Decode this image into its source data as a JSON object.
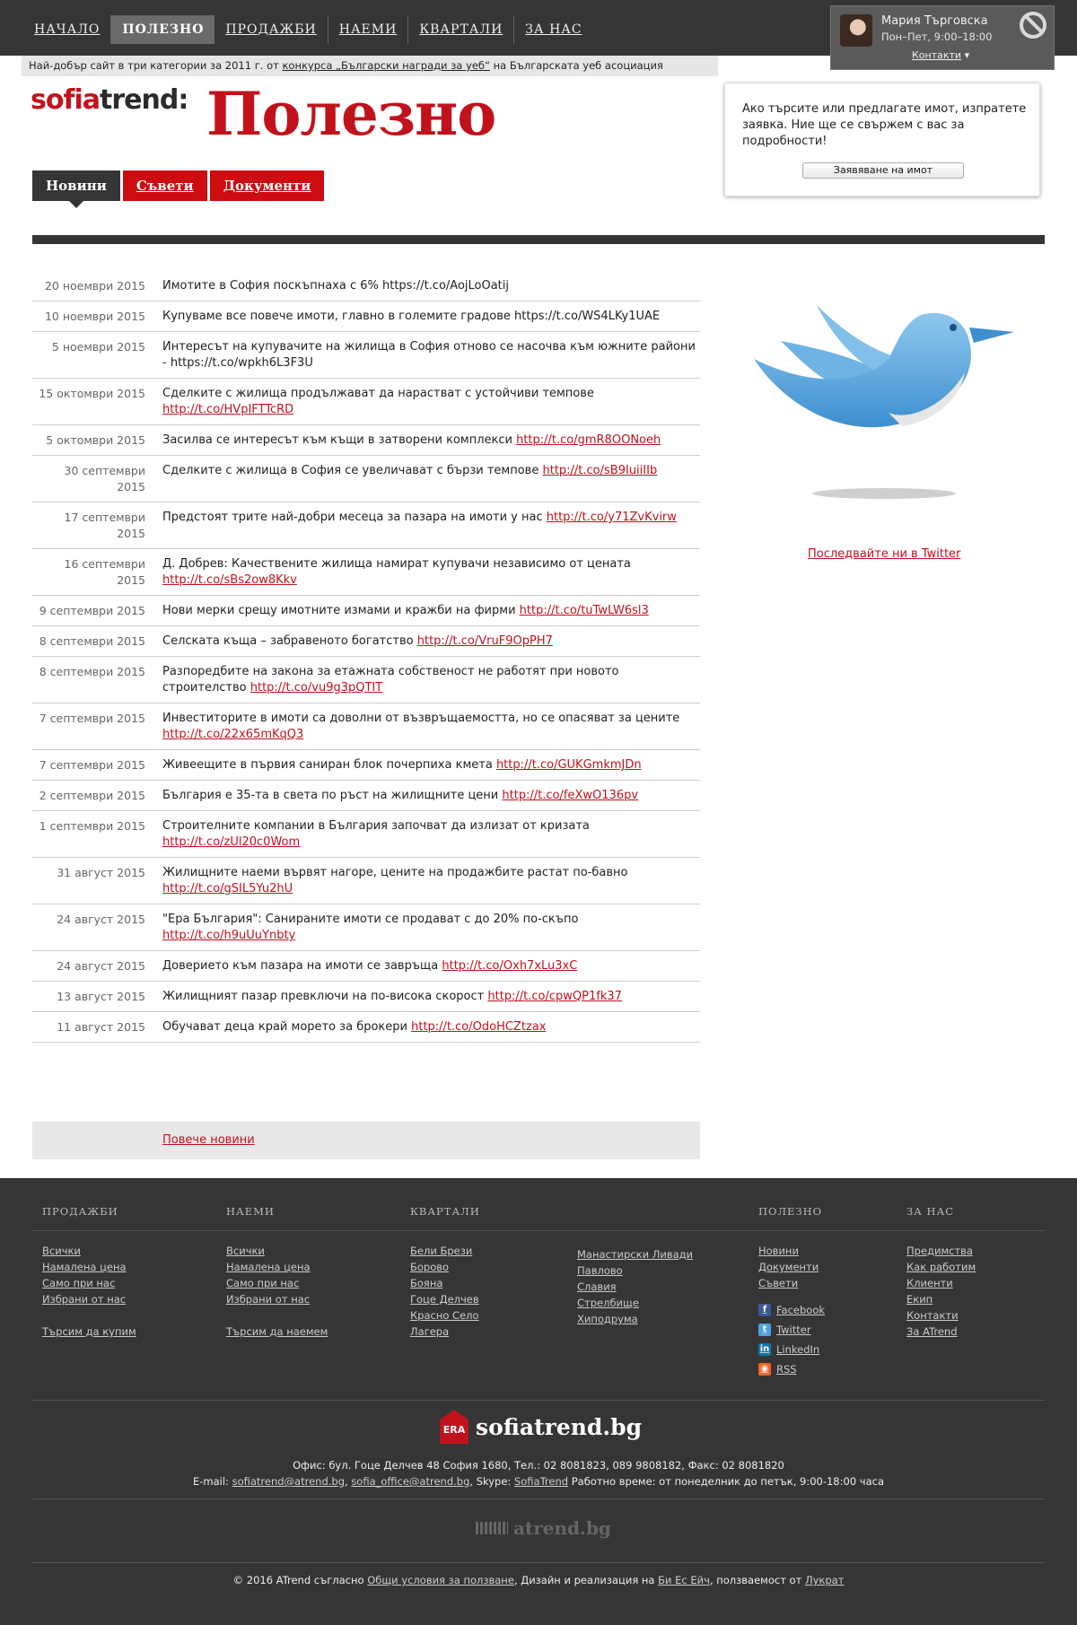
{
  "nav": {
    "items": [
      {
        "label": "НАЧАЛО",
        "active": false
      },
      {
        "label": "ПОЛЕЗНО",
        "active": true
      },
      {
        "label": "ПРОДАЖБИ",
        "active": false
      },
      {
        "label": "НАЕМИ",
        "active": false
      },
      {
        "label": "КВАРТАЛИ",
        "active": false
      },
      {
        "label": "ЗА НАС",
        "active": false
      }
    ]
  },
  "award": {
    "prefix": "Най-добър сайт в три категории за 2011 г. от ",
    "link": "конкурса „Български награди за уеб“",
    "suffix": " на Българската уеб асоциация"
  },
  "agent": {
    "name": "Мария Търговска",
    "hours": "Пон–Пет, 9:00–18:00",
    "contacts_label": "Контакти",
    "contacts_arrow": "▾"
  },
  "logo": {
    "part1": "sofia",
    "part2": "trend:"
  },
  "page_title": "Полезно",
  "tabs": [
    {
      "label": "Новини",
      "active": true
    },
    {
      "label": "Съвети",
      "active": false
    },
    {
      "label": "Документи",
      "active": false
    }
  ],
  "request_box": {
    "text": "Ако търсите или предлагате имот, изпратете заявка. Ние ще се свържем с вас за подробности!",
    "button": "Заявяване на имот"
  },
  "news": [
    {
      "date": "20 ноември 2015",
      "text": "Имотите в София поскъпнаха с 6% https://t.co/AojLoOatij",
      "link": ""
    },
    {
      "date": "10 ноември 2015",
      "text": "Купуваме все повече имоти, главно в големите градове https://t.co/WS4LKy1UAE",
      "link": ""
    },
    {
      "date": "5 ноември 2015",
      "text": "Интересът на купувачите на жилища в София отново се насочва към южните райони - https://t.co/wpkh6L3F3U",
      "link": ""
    },
    {
      "date": "15 октомври 2015",
      "text": "Сделките с жилища продължават да нарастват с устойчиви темпове ",
      "link": "http://t.co/HVpIFTTcRD"
    },
    {
      "date": "5 октомври 2015",
      "text": "Засилва се интересът към къщи в затворени комплекси ",
      "link": "http://t.co/gmR8OONoeh"
    },
    {
      "date": "30 септември 2015",
      "text": "Сделките с жилища в София се увеличават с бързи темпове ",
      "link": "http://t.co/sB9IuiiIIb"
    },
    {
      "date": "17 септември 2015",
      "text": "Предстоят трите най-добри месеца за пазара на имоти у нас ",
      "link": "http://t.co/y71ZvKvirw"
    },
    {
      "date": "16 септември 2015",
      "text": "Д. Добрев: Качествените жилища намират купувачи независимо от цената ",
      "link": "http://t.co/sBs2ow8Kkv"
    },
    {
      "date": "9 септември 2015",
      "text": "Нови мерки срещу имотните измами и кражби на фирми ",
      "link": "http://t.co/tuTwLW6sl3"
    },
    {
      "date": "8 септември 2015",
      "text": "Селската къща – забравеното богатство ",
      "link": "http://t.co/VruF9OpPH7"
    },
    {
      "date": "8 септември 2015",
      "text": "Разпоредбите на закона за етажната собственост не работят при новото строителство ",
      "link": "http://t.co/vu9g3pQTIT"
    },
    {
      "date": "7 септември 2015",
      "text": "Инвеститорите в имоти са доволни от възвръщаемостта, но се опасяват за цените ",
      "link": "http://t.co/22x65mKqQ3"
    },
    {
      "date": "7 септември 2015",
      "text": "Живеещите в първия саниран блок почерпиха кмета ",
      "link": "http://t.co/GUKGmkmJDn"
    },
    {
      "date": "2 септември 2015",
      "text": "България е 35-та в света по ръст на жилищните цени ",
      "link": "http://t.co/feXwO136pv"
    },
    {
      "date": "1 септември 2015",
      "text": "Строителните компании в България започват да излизат от кризата ",
      "link": "http://t.co/zUl20c0Wom"
    },
    {
      "date": "31 август 2015",
      "text": "Жилищните наеми вървят нагоре, цените на продажбите растат по-бавно ",
      "link": "http://t.co/gSIL5Yu2hU"
    },
    {
      "date": "24 август 2015",
      "text": "\"Ера България\": Санираните имоти се продават с до 20% по-скъпо ",
      "link": "http://t.co/h9uUuYnbty"
    },
    {
      "date": "24 август 2015",
      "text": "Доверието към пазара на имоти се завръща ",
      "link": "http://t.co/Oxh7xLu3xC"
    },
    {
      "date": "13 август 2015",
      "text": "Жилищният пазар превключи на по-висока скорост ",
      "link": "http://t.co/cpwQP1fk37"
    },
    {
      "date": "11 август 2015",
      "text": "Обучават деца край морето за брокери ",
      "link": "http://t.co/OdoHCZtzax"
    }
  ],
  "more_news": "Повече новини",
  "twitter": {
    "follow": "Последвайте ни в Twitter",
    "icon": "twitter-bird-icon"
  },
  "footer": {
    "sales": {
      "head": "ПРОДАЖБИ",
      "links": [
        "Всички",
        "Намалена цена",
        "Само при нас",
        "Избрани от нас"
      ],
      "extra": "Търсим да купим"
    },
    "rent": {
      "head": "НАЕМИ",
      "links": [
        "Всички",
        "Намалена цена",
        "Само при нас",
        "Избрани от нас"
      ],
      "extra": "Търсим да наемем"
    },
    "districts": {
      "head": "КВАРТАЛИ",
      "col1": [
        "Бели Брези",
        "Борово",
        "Бояна",
        "Гоце Делчев",
        "Красно Село",
        "Лагера"
      ],
      "col2": [
        "Манастирски Ливади",
        "Павлово",
        "Славия",
        "Стрелбище",
        "Хиподрума"
      ]
    },
    "useful": {
      "head": "ПОЛЕЗНО",
      "links": [
        "Новини",
        "Документи",
        "Съвети"
      ],
      "social": [
        {
          "label": "Facebook",
          "glyph": "f",
          "color": "#3b5998"
        },
        {
          "label": "Twitter",
          "glyph": "t",
          "color": "#4aa3df"
        },
        {
          "label": "LinkedIn",
          "glyph": "in",
          "color": "#0e76a8"
        },
        {
          "label": "RSS",
          "glyph": "◉",
          "color": "#f26522"
        }
      ]
    },
    "about": {
      "head": "ЗА НАС",
      "links": [
        "Предимства",
        "Как работим",
        "Клиенти",
        "Екип",
        "Контакти",
        "За ATrend"
      ]
    },
    "brand": {
      "era": "ERA",
      "site": "sofiatrend.bg"
    },
    "address": "Офис: бул. Гоце Делчев 48 София 1680, Тел.: 02 8081823, 089 9808182, Факс: 02 8081820",
    "email_label": "E-mail: ",
    "email1": "sofiatrend@atrend.bg",
    "email_sep": ", ",
    "email2": "sofia_office@atrend.bg",
    "skype_label": ", Skype: ",
    "skype": "SofiaTrend",
    "work_hours": " Работно време: от понеделник до петък, 9:00-18:00 часа",
    "atrend": "atrend.bg",
    "copy_prefix": "© 2016 ATrend съгласно ",
    "copy_terms": "Общи условия за ползване",
    "copy_mid": ", Дизайн и реализация на ",
    "copy_design": "Би Ес Ейч",
    "copy_mid2": ", ползваемост от ",
    "copy_ux": "Лукрат"
  }
}
